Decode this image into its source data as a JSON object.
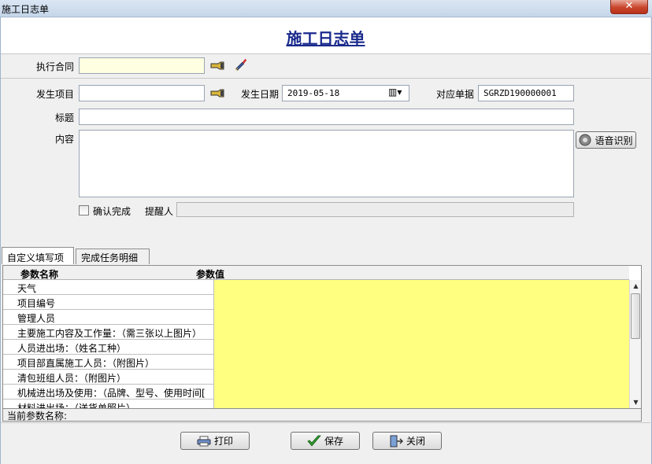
{
  "window": {
    "title": "施工日志单",
    "close_label": "✕"
  },
  "header": {
    "title": "施工日志单"
  },
  "form": {
    "contract_label": "执行合同",
    "contract_value": "",
    "project_label": "发生项目",
    "project_value": "",
    "date_label": "发生日期",
    "date_value": "2019-05-18",
    "doc_label": "对应单据",
    "doc_value": "SGRZD190000001",
    "title_label": "标题",
    "title_value": "",
    "content_label": "内容",
    "content_value": "",
    "voice_button": "语音识别",
    "confirm_label": "确认完成",
    "reminder_label": "提醒人",
    "reminder_value": ""
  },
  "tabs": [
    {
      "label": "自定义填写项",
      "active": true
    },
    {
      "label": "完成任务明细",
      "active": false
    }
  ],
  "grid": {
    "columns": [
      "参数名称",
      "参数值"
    ],
    "rows": [
      {
        "name": "天气",
        "value": ""
      },
      {
        "name": "项目编号",
        "value": ""
      },
      {
        "name": "管理人员",
        "value": ""
      },
      {
        "name": "主要施工内容及工作量：（需三张以上图片）",
        "value": ""
      },
      {
        "name": "人员进出场：（姓名工种）",
        "value": ""
      },
      {
        "name": "项目部直属施工人员：（附图片）",
        "value": ""
      },
      {
        "name": "清包班组人员：（附图片）",
        "value": ""
      },
      {
        "name": "机械进出场及使用：（品牌、型号、使用时间[",
        "value": ""
      },
      {
        "name": "材料进出场：（送货单照片）",
        "value": ""
      }
    ],
    "current_label": "当前参数名称:"
  },
  "footer": {
    "print": "打印",
    "save": "保存",
    "close": "关闭"
  },
  "colors": {
    "title": "#1a2a8c",
    "value_cell": "#ffff80",
    "contract_field": "#ffffe1"
  }
}
